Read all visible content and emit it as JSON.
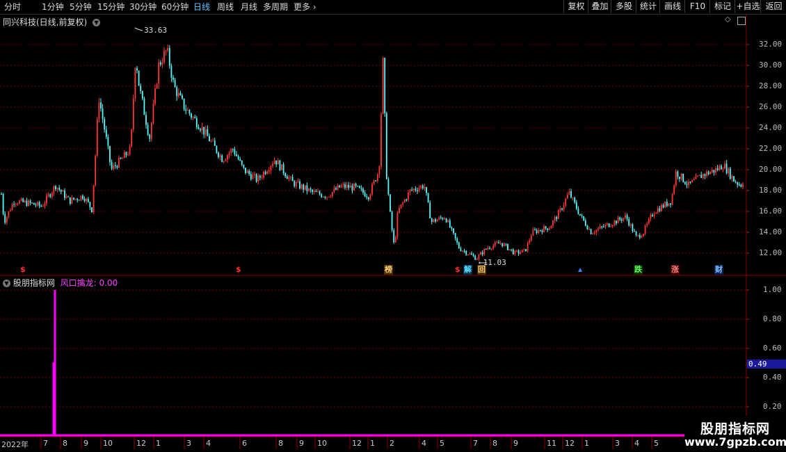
{
  "toolbar": {
    "periods": [
      "分时",
      "1分钟",
      "5分钟",
      "15分钟",
      "30分钟",
      "60分钟",
      "日线",
      "周线",
      "月线",
      "多周期",
      "更多"
    ],
    "active_period": "日线",
    "buttons": [
      "复权",
      "叠加",
      "多股",
      "统计",
      "画线",
      "F10",
      "标记",
      "+自选",
      "返回"
    ]
  },
  "main_pane": {
    "title": "同兴科技(日线,前复权)",
    "price_labels": [
      "32.00",
      "30.00",
      "28.00",
      "26.00",
      "24.00",
      "22.00",
      "20.00",
      "18.00",
      "16.00",
      "14.00",
      "12.00"
    ],
    "high_label": "33.63",
    "low_label": "11.03",
    "event_markers": [
      {
        "text": "$",
        "color": "#ff3030",
        "bg": ""
      },
      {
        "text": "$",
        "color": "#ff3030",
        "bg": ""
      },
      {
        "text": "榜",
        "color": "#ffd080",
        "bg": "#4a3000"
      },
      {
        "text": "$",
        "color": "#ff3030",
        "bg": ""
      },
      {
        "text": "解",
        "color": "#60e0ff",
        "bg": "#003050"
      },
      {
        "text": "回",
        "color": "#ffd080",
        "bg": "#4a3000"
      },
      {
        "text": "▲",
        "color": "#4080ff",
        "bg": ""
      },
      {
        "text": "跌",
        "color": "#60ff60",
        "bg": "#003000"
      },
      {
        "text": "涨",
        "color": "#ff8080",
        "bg": "#400000"
      },
      {
        "text": "财",
        "color": "#80c0ff",
        "bg": "#002050"
      }
    ]
  },
  "indicator_pane": {
    "title": "股朋指标网",
    "indicator_name": "风口擒龙:",
    "indicator_value": "0.00",
    "axis_labels": [
      "1.00",
      "0.80",
      "0.60",
      "0.40",
      "0.20"
    ],
    "current_value_tag": "0.49",
    "colors": {
      "line": "#ff00ff",
      "tag_bg": "#1a1a9a"
    }
  },
  "date_axis": {
    "labels": [
      "2022年",
      "7",
      "8",
      "9",
      "10",
      "12",
      "1",
      "3",
      "4",
      "6",
      "8",
      "9",
      "10",
      "12",
      "1",
      "2",
      "4",
      "5",
      "7",
      "8",
      "9",
      "11",
      "12",
      "1",
      "3",
      "4",
      "5"
    ]
  },
  "watermark": {
    "title": "股朋指标网",
    "url": "www.7gpzb.com"
  },
  "colors": {
    "up": "#ff3838",
    "down": "#54ffff",
    "grid": "#7a0000",
    "axis": "#8a0000"
  },
  "chart_data": {
    "type": "candlestick",
    "title": "同兴科技(日线,前复权)",
    "ylim": [
      11,
      34
    ],
    "high": 33.63,
    "low": 11.03,
    "x": [
      "2022-06",
      "2022-07",
      "2022-08",
      "2022-09",
      "2022-10",
      "2022-12",
      "2023-01",
      "2023-03",
      "2023-04",
      "2023-06",
      "2023-08",
      "2023-09",
      "2023-10",
      "2023-12",
      "2024-01",
      "2024-02",
      "2024-04",
      "2024-05",
      "2024-07",
      "2024-08",
      "2024-09",
      "2024-11",
      "2024-12",
      "2025-01",
      "2025-03",
      "2025-04",
      "2025-05"
    ],
    "close_approx": [
      17.0,
      16.5,
      24.0,
      20.5,
      28.0,
      31.0,
      28.0,
      23.5,
      21.0,
      19.0,
      18.5,
      17.5,
      18.0,
      18.5,
      16.0,
      17.5,
      15.5,
      12.5,
      12.0,
      13.0,
      14.5,
      17.5,
      14.5,
      15.0,
      16.5,
      18.5,
      20.0
    ],
    "indicator": {
      "name": "风口擒龙",
      "values": [
        0,
        1,
        0,
        0,
        0,
        0,
        0,
        0,
        0,
        0,
        0,
        0,
        0,
        0,
        0,
        0,
        0,
        0,
        0,
        0,
        0,
        0,
        0,
        0,
        0,
        0,
        0
      ],
      "ylim": [
        0,
        1
      ]
    }
  }
}
